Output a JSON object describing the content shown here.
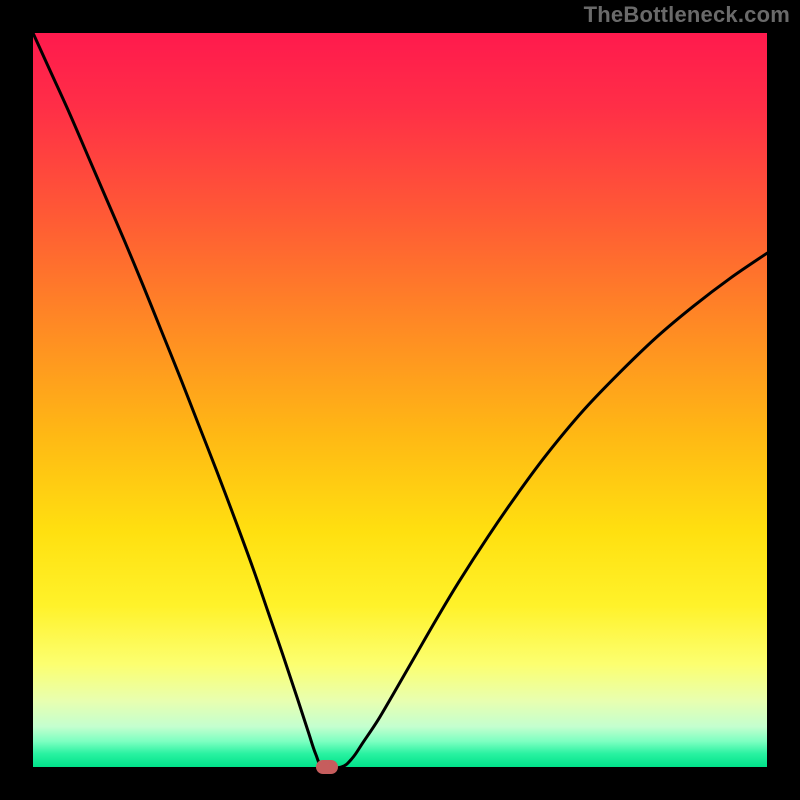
{
  "watermark": "TheBottleneck.com",
  "colors": {
    "frame": "#000000",
    "watermark": "#6a6a6a",
    "curve": "#000000",
    "marker": "#c65d5d",
    "gradient_stops": [
      {
        "offset": 0.0,
        "color": "#ff1a4d"
      },
      {
        "offset": 0.1,
        "color": "#ff2e47"
      },
      {
        "offset": 0.25,
        "color": "#ff5a35"
      },
      {
        "offset": 0.4,
        "color": "#ff8a24"
      },
      {
        "offset": 0.55,
        "color": "#ffb914"
      },
      {
        "offset": 0.68,
        "color": "#ffe010"
      },
      {
        "offset": 0.78,
        "color": "#fff22a"
      },
      {
        "offset": 0.86,
        "color": "#fcff70"
      },
      {
        "offset": 0.91,
        "color": "#e8ffb0"
      },
      {
        "offset": 0.945,
        "color": "#c4ffcf"
      },
      {
        "offset": 0.965,
        "color": "#7dffc1"
      },
      {
        "offset": 0.982,
        "color": "#29f2a1"
      },
      {
        "offset": 1.0,
        "color": "#00e28a"
      }
    ]
  },
  "chart_data": {
    "type": "line",
    "title": "",
    "xlabel": "",
    "ylabel": "",
    "xlim": [
      0,
      100
    ],
    "ylim": [
      0,
      100
    ],
    "grid": false,
    "legend": false,
    "marker": {
      "x": 40,
      "y": 0
    },
    "series": [
      {
        "name": "bottleneck-curve",
        "x": [
          0.0,
          2.5,
          5.0,
          7.5,
          10.0,
          12.5,
          15.0,
          17.5,
          20.0,
          22.5,
          25.0,
          27.5,
          30.0,
          32.0,
          34.0,
          36.0,
          37.5,
          38.5,
          39.5,
          42.0,
          43.5,
          45.0,
          47.0,
          49.0,
          52.0,
          55.0,
          58.0,
          62.0,
          66.0,
          70.0,
          75.0,
          80.0,
          85.0,
          90.0,
          95.0,
          100.0
        ],
        "y": [
          100.0,
          94.5,
          89.0,
          83.2,
          77.4,
          71.6,
          65.6,
          59.4,
          53.2,
          46.8,
          40.4,
          33.8,
          27.0,
          21.2,
          15.4,
          9.4,
          4.8,
          1.8,
          0.0,
          0.0,
          1.2,
          3.4,
          6.4,
          9.8,
          15.0,
          20.2,
          25.2,
          31.4,
          37.2,
          42.6,
          48.6,
          53.8,
          58.6,
          62.8,
          66.6,
          70.0
        ]
      }
    ]
  }
}
